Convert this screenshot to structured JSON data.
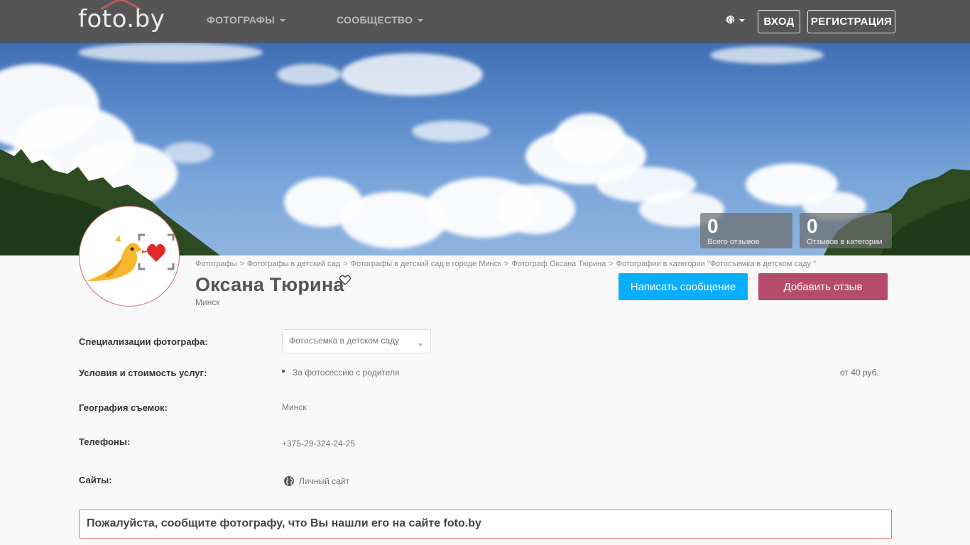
{
  "header": {
    "logo": "foto.by",
    "nav": [
      {
        "label": "ФОТОГРАФЫ"
      },
      {
        "label": "СООБЩЕСТВО"
      }
    ],
    "language_icon": "globe-icon",
    "login_label": "ВХОД",
    "register_label": "РЕГИСТРАЦИЯ"
  },
  "stats": [
    {
      "value": "0",
      "label": "Всего отзывов"
    },
    {
      "value": "0",
      "label": "Отзывов в категории"
    }
  ],
  "breadcrumb": [
    "Фотографы",
    "Фотографы в детский сад",
    "Фотографы в детский сад в городе Минск",
    "Фотограф Оксана Тюрина",
    "Фотографии в категории \"Фотосъемка в детском саду \""
  ],
  "breadcrumb_separator": ">",
  "profile": {
    "name": "Оксана Тюрина",
    "city": "Минск",
    "message_button": "Написать сообщение",
    "review_button": "Добавить отзыв"
  },
  "details": {
    "specializations_label": "Специализации фотографа:",
    "specialization_selected": "Фотосъемка в детском саду",
    "conditions_label": "Условия и стоимость услуг:",
    "service_name": "За фотосессию с родителя",
    "service_price": "от 40 руб.",
    "geography_label": "География съемок:",
    "geography_value": "Минск",
    "phones_label": "Телефоны:",
    "phone_value": "+375-29-324-24-25",
    "sites_label": "Сайты:",
    "site_link": "Личный сайт"
  },
  "notice": "Пожалуйста, сообщите фотографу, что Вы нашли его на сайте foto.by",
  "colors": {
    "header_bg": "#555555",
    "message_button": "#0aaeff",
    "review_button": "#b54c6b",
    "notice_border": "#e07b7b"
  }
}
